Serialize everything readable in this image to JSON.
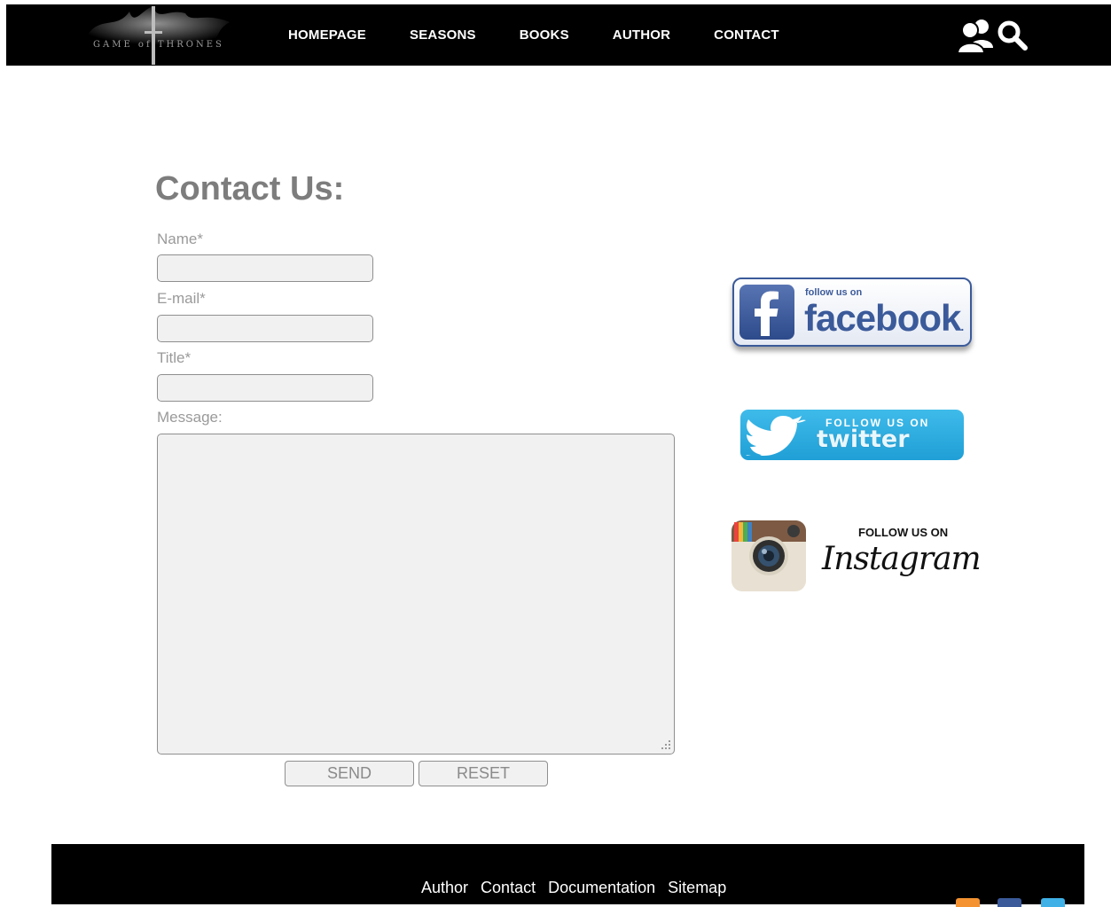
{
  "header": {
    "logo_text": "GAME of THRONES",
    "nav": [
      {
        "label": "HOMEPAGE"
      },
      {
        "label": "SEASONS"
      },
      {
        "label": "BOOKS"
      },
      {
        "label": "AUTHOR"
      },
      {
        "label": "CONTACT"
      }
    ],
    "icons": [
      "users-icon",
      "search-icon"
    ]
  },
  "contact": {
    "title": "Contact Us:",
    "fields": {
      "name_label": "Name*",
      "name_value": "",
      "email_label": "E-mail*",
      "email_value": "",
      "title_label": "Title*",
      "title_value": "",
      "message_label": "Message:",
      "message_value": ""
    },
    "send_label": "SEND",
    "reset_label": "RESET"
  },
  "social": {
    "facebook": {
      "small": "follow us on",
      "big": "facebook",
      "dot": "."
    },
    "twitter": {
      "small": "FOLLOW US ON",
      "big": "twitter"
    },
    "instagram": {
      "small": "FOLLOW US ON",
      "big": "Instagram"
    }
  },
  "footer": {
    "links": [
      {
        "label": "Author"
      },
      {
        "label": "Contact"
      },
      {
        "label": "Documentation"
      },
      {
        "label": "Sitemap"
      }
    ],
    "icons": [
      "rss-icon",
      "facebook-icon",
      "twitter-icon"
    ]
  },
  "colors": {
    "nav_bg": "#000000",
    "title": "#7d7d7d",
    "label": "#9a9a9a",
    "field_bg": "#f1f1f1",
    "facebook": "#3b5a9a",
    "twitter": "#2aaee2",
    "rss": "#f49231"
  }
}
